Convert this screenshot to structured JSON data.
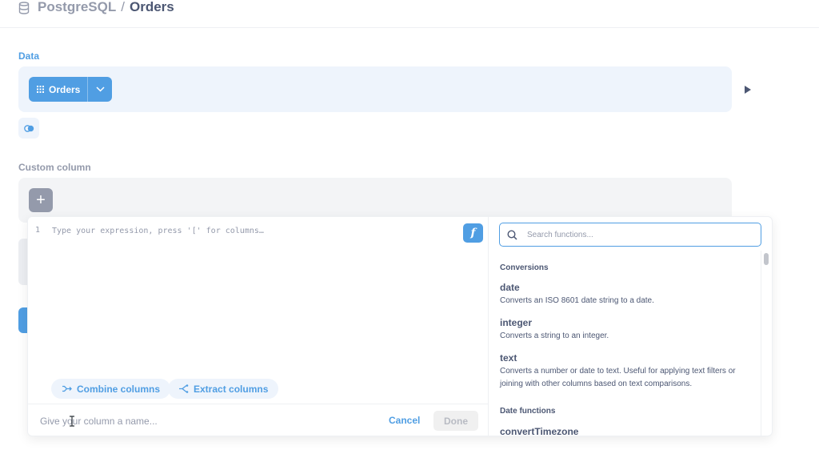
{
  "header": {
    "database": "PostgreSQL",
    "separator": "/",
    "table": "Orders"
  },
  "data_section": {
    "label": "Data",
    "table_name": "Orders"
  },
  "custom_column_section": {
    "label": "Custom column",
    "add_symbol": "+"
  },
  "editor": {
    "line_number": "1",
    "placeholder": "Type your expression, press '[' for columns…",
    "function_button": "f",
    "shortcuts": {
      "combine": "Combine columns",
      "extract": "Extract columns"
    },
    "name_placeholder": "Give your column a name...",
    "cancel_label": "Cancel",
    "done_label": "Done"
  },
  "functions": {
    "search_placeholder": "Search functions...",
    "groups": [
      {
        "category": "Conversions",
        "items": [
          {
            "name": "date",
            "description": "Converts an ISO 8601 date string to a date."
          },
          {
            "name": "integer",
            "description": "Converts a string to an integer."
          },
          {
            "name": "text",
            "description": "Converts a number or date to text. Useful for applying text filters or joining with other columns based on text comparisons."
          }
        ]
      },
      {
        "category": "Date functions",
        "items": [
          {
            "name": "convertTimezone",
            "description": ""
          }
        ]
      }
    ]
  },
  "colors": {
    "brand": "#509ee3",
    "text_dark": "#4c5773",
    "text_light": "#949aab",
    "step_bg_blue": "#eef4fc",
    "step_bg_grey": "#f3f4f6"
  }
}
